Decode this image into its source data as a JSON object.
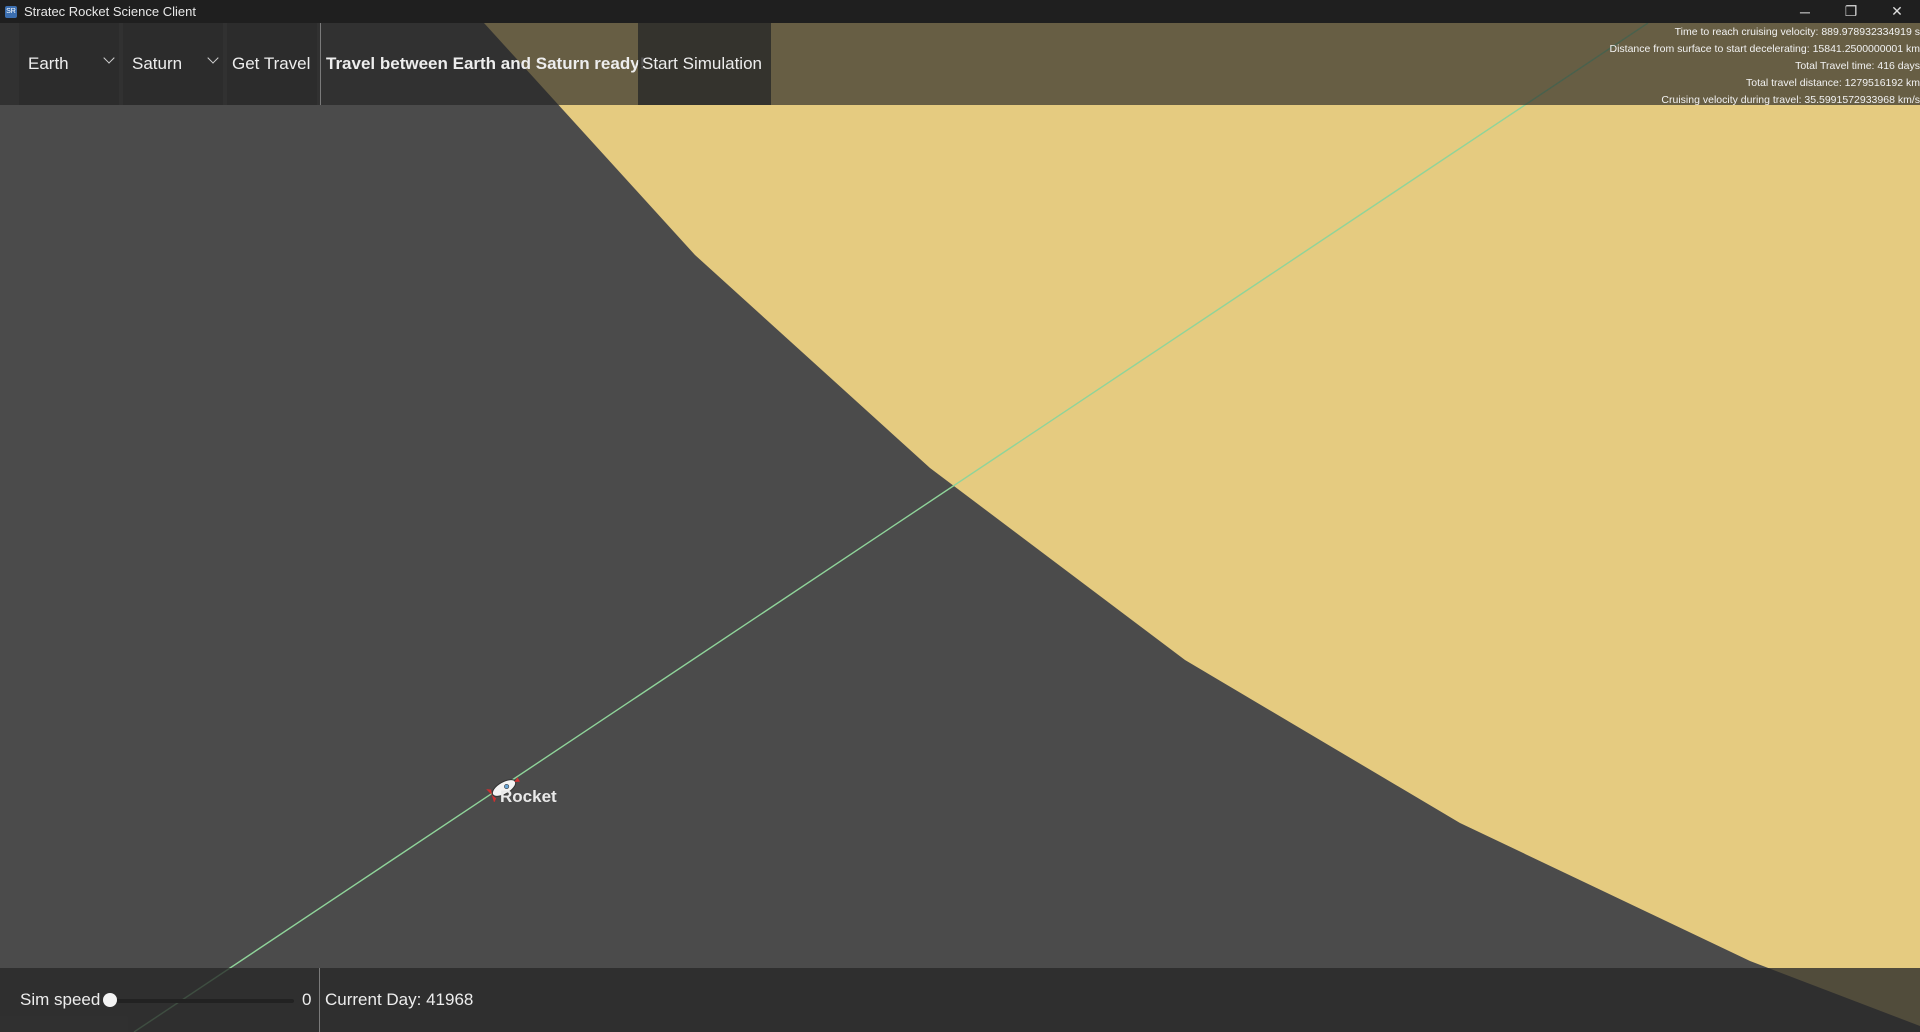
{
  "window": {
    "title": "Stratec Rocket Science Client",
    "app_icon_text": "SR",
    "minimize_glyph": "─",
    "restore_glyph": "❐",
    "close_glyph": "✕"
  },
  "toolbar": {
    "origin_select": "Earth",
    "destination_select": "Saturn",
    "get_travel_label": "Get Travel",
    "status_text": "Travel between Earth and Saturn ready!",
    "start_simulation_label": "Start Simulation"
  },
  "stats": {
    "time_to_cruise": "Time to reach cruising velocity: 889.978932334919 s",
    "decel_distance": "Distance from surface to start decelerating: 15841.2500000001 km",
    "total_time": "Total Travel time: 416 days",
    "total_distance": "Total travel distance: 1279516192 km",
    "cruise_velocity": "Cruising velocity during travel: 35.5991572933968 km/s"
  },
  "scene": {
    "rocket_label": "Rocket",
    "planet_color": "#e5cb80",
    "space_color": "#4b4b4b",
    "trajectory_color": "#8fd49a"
  },
  "bottombar": {
    "sim_speed_label": "Sim speed",
    "sim_speed_value": "0",
    "sim_speed_fraction": 0,
    "current_day": "Current Day: 41968"
  }
}
